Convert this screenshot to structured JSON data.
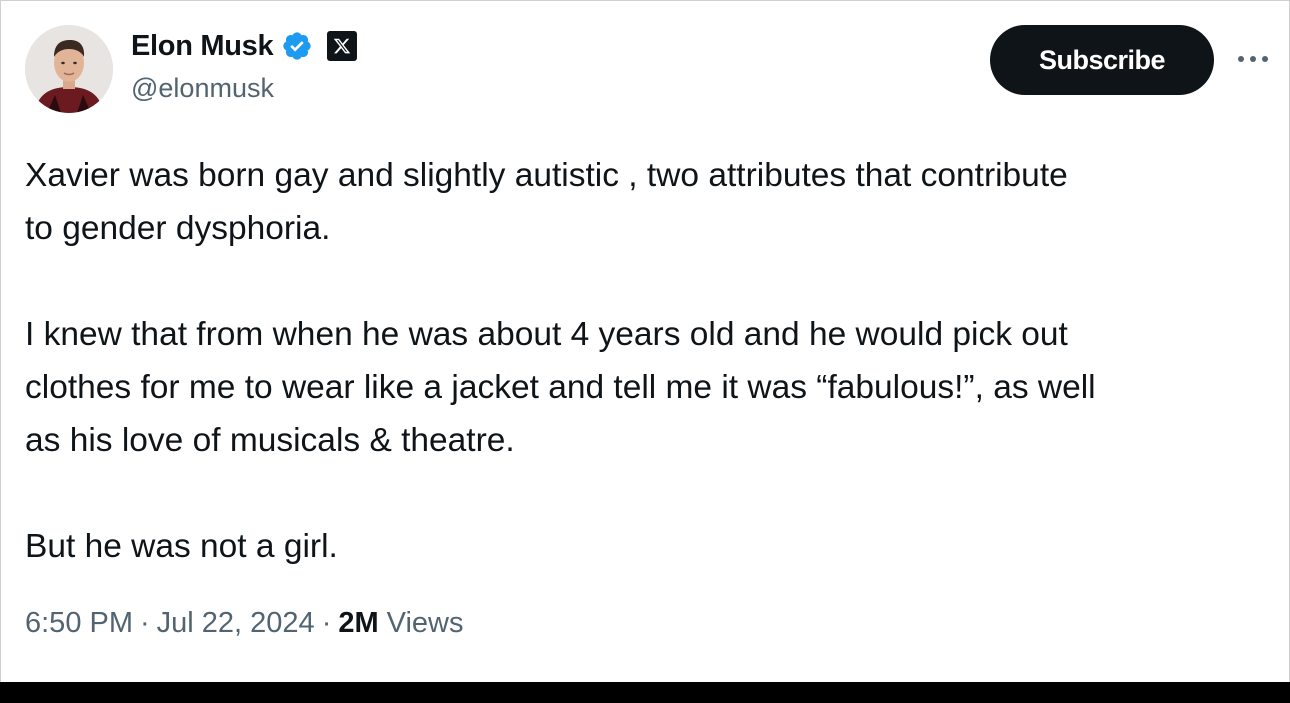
{
  "author": {
    "display_name": "Elon Musk",
    "handle": "@elonmusk",
    "verified": true,
    "affiliate_badge": "x-logo-icon",
    "avatar": "profile-photo"
  },
  "actions": {
    "subscribe_label": "Subscribe",
    "more_icon": "more-options-icon"
  },
  "tweet": {
    "paragraphs": [
      [
        "Xavier was born gay and slightly autistic , two attributes that contribute",
        "to gender dysphoria."
      ],
      [
        "I knew that from when he was about 4 years old and he would pick out",
        "clothes for me to wear like a jacket and tell me it was “fabulous!”, as well",
        "as his love of musicals & theatre."
      ],
      [
        "But he was not a girl."
      ]
    ]
  },
  "meta": {
    "time": "6:50 PM",
    "separator": "·",
    "date": "Jul 22, 2024",
    "views_count": "2M",
    "views_label": "Views"
  },
  "colors": {
    "text_primary": "#0f1419",
    "text_secondary": "#536471",
    "verified_blue": "#1d9bf0",
    "button_bg": "#0f1419",
    "button_text": "#ffffff",
    "frame": "#000000"
  }
}
